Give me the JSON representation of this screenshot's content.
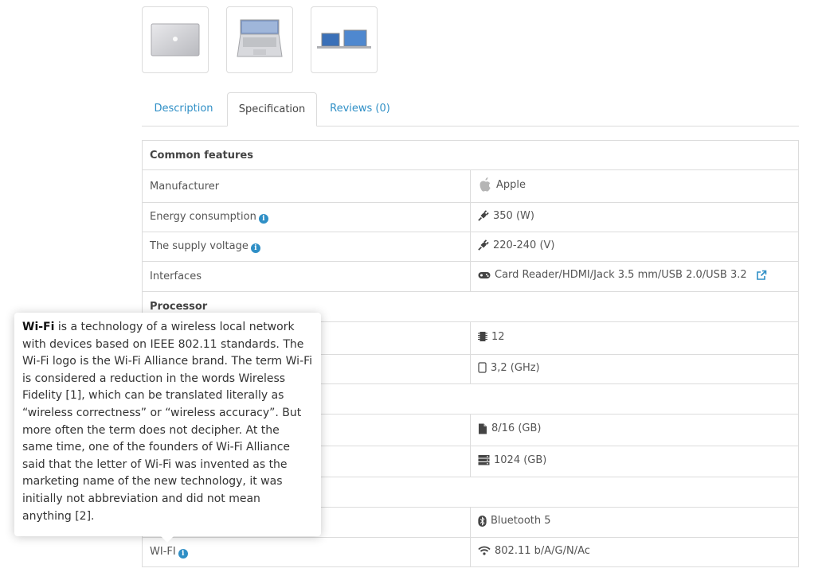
{
  "tabs": [
    {
      "label": "Description"
    },
    {
      "label": "Specification"
    },
    {
      "label": "Reviews (0)"
    }
  ],
  "spec": {
    "groups": {
      "common": "Common features",
      "processor": "Processor"
    },
    "rows": {
      "manufacturer": {
        "name": "Manufacturer",
        "value": "Apple"
      },
      "energy": {
        "name": "Energy consumption",
        "value": "350 (W)"
      },
      "voltage": {
        "name": "The supply voltage",
        "value": "220-240 (V)"
      },
      "interfaces": {
        "name": "Interfaces",
        "value": "Card Reader/HDMI/Jack 3.5 mm/USB 2.0/USB 3.2"
      },
      "cores": {
        "value": "12"
      },
      "frequency": {
        "value": "3,2 (GHz)"
      },
      "ram": {
        "value": "8/16 (GB)"
      },
      "storage": {
        "value": "1024 (GB)"
      },
      "bluetooth": {
        "value": "Bluetooth 5"
      },
      "wifi": {
        "name": "WI-FI",
        "value": "802.11 b/A/G/N/Ac"
      }
    }
  },
  "tooltip": {
    "term": "Wi-Fi",
    "text": " is a technology of a wireless local network with devices based on IEEE 802.11 standards. The Wi-Fi logo is the Wi-Fi Alliance brand. The term Wi-Fi is considered a reduction in the words Wireless Fidelity [1], which can be translated literally as “wireless correctness” or “wireless accuracy”. But more often the term does not decipher. At the same time, one of the founders of Wi-Fi Alliance said that the letter of Wi-Fi was invented as the marketing name of the new technology, it was initially not abbreviation and did not mean anything [2]."
  },
  "colors": {
    "accent": "#2f8fc6",
    "border": "#dcdcdc"
  }
}
